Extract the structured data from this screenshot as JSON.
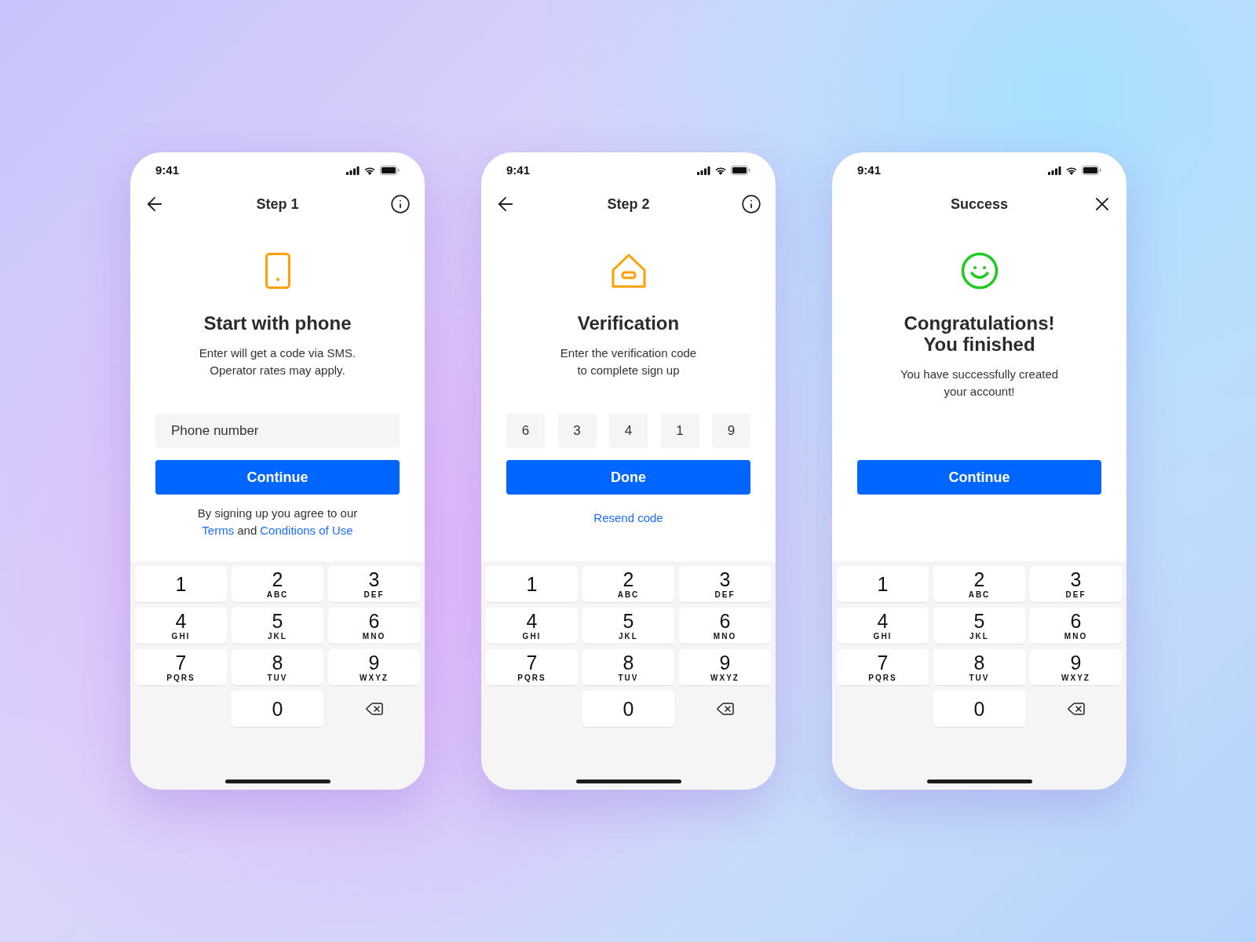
{
  "screens": [
    {
      "kind": "phone",
      "time": "9:41",
      "title": "Step 1",
      "left_button": {
        "kind": "back"
      },
      "right_button": {
        "kind": "info"
      },
      "hero": {
        "kind": "phone"
      },
      "heading": [
        "Start with phone"
      ],
      "body": [
        "Enter will get a code via SMS.",
        "Operator rates may apply."
      ],
      "field": {
        "placeholder": "Phone number"
      },
      "button": "Continue",
      "legal": {
        "lead": "By signing up you agree to our",
        "link1": "Terms",
        "joiner": "and",
        "link2": "Conditions of Use"
      },
      "keys": [
        {
          "kind": "key",
          "digit": "1"
        },
        {
          "kind": "key",
          "digit": "2",
          "letters": "ABC"
        },
        {
          "kind": "key",
          "digit": "3",
          "letters": "DEF"
        },
        {
          "kind": "key",
          "digit": "4",
          "letters": "GHI"
        },
        {
          "kind": "key",
          "digit": "5",
          "letters": "JKL"
        },
        {
          "kind": "key",
          "digit": "6",
          "letters": "MNO"
        },
        {
          "kind": "key",
          "digit": "7",
          "letters": "PQRS"
        },
        {
          "kind": "key",
          "digit": "8",
          "letters": "TUV"
        },
        {
          "kind": "key",
          "digit": "9",
          "letters": "WXYZ"
        },
        {
          "kind": "key",
          "digit": "0"
        },
        {
          "kind": "backspace"
        }
      ]
    },
    {
      "kind": "code",
      "time": "9:41",
      "title": "Step 2",
      "left_button": {
        "kind": "back"
      },
      "right_button": {
        "kind": "info"
      },
      "hero": {
        "kind": "house"
      },
      "heading": [
        "Verification"
      ],
      "body": [
        "Enter the verification code",
        "to complete sign up"
      ],
      "code": [
        "6",
        "3",
        "4",
        "1",
        "9"
      ],
      "button": "Done",
      "link": "Resend code",
      "keys": [
        {
          "kind": "key",
          "digit": "1"
        },
        {
          "kind": "key",
          "digit": "2",
          "letters": "ABC"
        },
        {
          "kind": "key",
          "digit": "3",
          "letters": "DEF"
        },
        {
          "kind": "key",
          "digit": "4",
          "letters": "GHI"
        },
        {
          "kind": "key",
          "digit": "5",
          "letters": "JKL"
        },
        {
          "kind": "key",
          "digit": "6",
          "letters": "MNO"
        },
        {
          "kind": "key",
          "digit": "7",
          "letters": "PQRS"
        },
        {
          "kind": "key",
          "digit": "8",
          "letters": "TUV"
        },
        {
          "kind": "key",
          "digit": "9",
          "letters": "WXYZ"
        },
        {
          "kind": "key",
          "digit": "0"
        },
        {
          "kind": "backspace"
        }
      ]
    },
    {
      "kind": "success",
      "time": "9:41",
      "title": "Success",
      "right_button": {
        "kind": "close"
      },
      "hero": {
        "kind": "smiley"
      },
      "heading": [
        "Congratulations!",
        "You finished"
      ],
      "body": [
        "You have successfully created",
        "your account!"
      ],
      "button": "Continue",
      "keys": [
        {
          "kind": "key",
          "digit": "1"
        },
        {
          "kind": "key",
          "digit": "2",
          "letters": "ABC"
        },
        {
          "kind": "key",
          "digit": "3",
          "letters": "DEF"
        },
        {
          "kind": "key",
          "digit": "4",
          "letters": "GHI"
        },
        {
          "kind": "key",
          "digit": "5",
          "letters": "JKL"
        },
        {
          "kind": "key",
          "digit": "6",
          "letters": "MNO"
        },
        {
          "kind": "key",
          "digit": "7",
          "letters": "PQRS"
        },
        {
          "kind": "key",
          "digit": "8",
          "letters": "TUV"
        },
        {
          "kind": "key",
          "digit": "9",
          "letters": "WXYZ"
        },
        {
          "kind": "key",
          "digit": "0"
        },
        {
          "kind": "backspace"
        }
      ]
    }
  ]
}
